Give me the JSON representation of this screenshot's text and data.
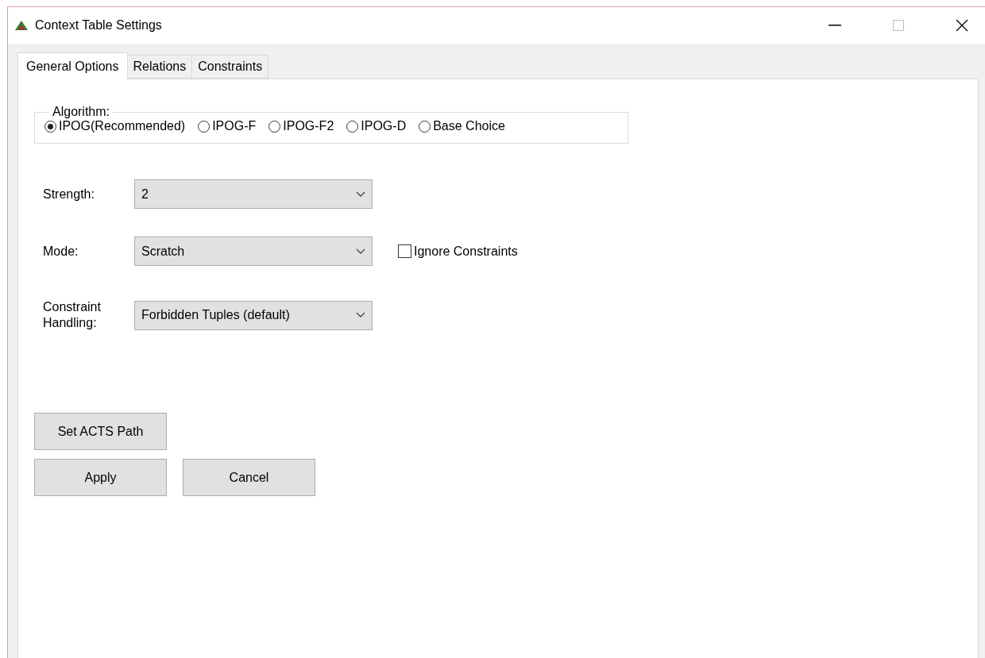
{
  "window": {
    "title": "Context Table Settings"
  },
  "tabs": [
    {
      "label": "General Options",
      "selected": true
    },
    {
      "label": "Relations",
      "selected": false
    },
    {
      "label": "Constraints",
      "selected": false
    }
  ],
  "algorithm": {
    "legend": "Algorithm:",
    "options": [
      {
        "label": "IPOG(Recommended)",
        "selected": true
      },
      {
        "label": "IPOG-F",
        "selected": false
      },
      {
        "label": "IPOG-F2",
        "selected": false
      },
      {
        "label": "IPOG-D",
        "selected": false
      },
      {
        "label": "Base Choice",
        "selected": false
      }
    ]
  },
  "fields": [
    {
      "label": "Strength:",
      "value": "2"
    },
    {
      "label": "Mode:",
      "value": "Scratch",
      "checkbox": {
        "label": "Ignore Constraints",
        "checked": false
      }
    },
    {
      "label": "Constraint Handling:",
      "value": "Forbidden Tuples (default)"
    }
  ],
  "path_button": "Set ACTS Path",
  "buttons": [
    "Apply",
    "Cancel"
  ]
}
